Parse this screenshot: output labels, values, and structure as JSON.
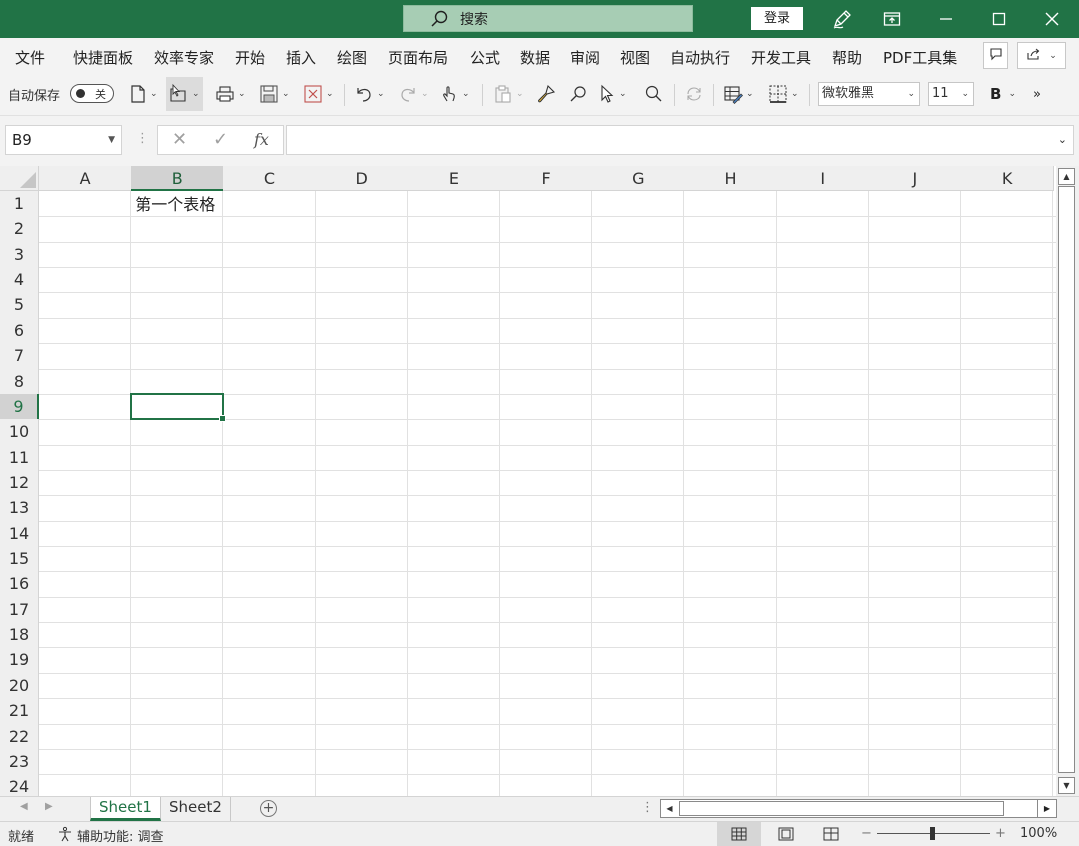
{
  "titlebar": {
    "search_placeholder": "搜索",
    "login_label": "登录",
    "brand_color": "#217346",
    "icons": [
      "pen-icon",
      "ribbon-display-icon",
      "minimize-icon",
      "maximize-icon",
      "close-icon"
    ]
  },
  "menu": {
    "items": [
      "文件",
      "快捷面板",
      "效率专家",
      "开始",
      "插入",
      "绘图",
      "页面布局",
      "公式",
      "数据",
      "审阅",
      "视图",
      "自动执行",
      "开发工具",
      "帮助",
      "PDF工具集"
    ]
  },
  "qat": {
    "autosave_label": "自动保存",
    "autosave_state": "关",
    "font_name": "微软雅黑",
    "font_size": "11",
    "bold_label": "B",
    "more_label": "»"
  },
  "formula_bar": {
    "name_box": "B9",
    "cancel_symbol": "✕",
    "enter_symbol": "✓",
    "fx_label": "fx",
    "formula_value": ""
  },
  "sheet": {
    "columns": [
      "A",
      "B",
      "C",
      "D",
      "E",
      "F",
      "G",
      "H",
      "I",
      "J",
      "K"
    ],
    "rows": [
      "1",
      "2",
      "3",
      "4",
      "5",
      "6",
      "7",
      "8",
      "9",
      "10",
      "11",
      "12",
      "13",
      "14",
      "15",
      "16",
      "17",
      "18",
      "19",
      "20",
      "21",
      "22",
      "23",
      "24"
    ],
    "selected_cell": "B9",
    "cells": {
      "B1": "第一个表格"
    }
  },
  "tabs": {
    "sheets": [
      "Sheet1",
      "Sheet2"
    ],
    "active": "Sheet1",
    "add_label": "+"
  },
  "status": {
    "ready": "就绪",
    "accessibility": "辅助功能: 调查",
    "zoom_minus": "−",
    "zoom_plus": "+",
    "zoom": "100%"
  }
}
